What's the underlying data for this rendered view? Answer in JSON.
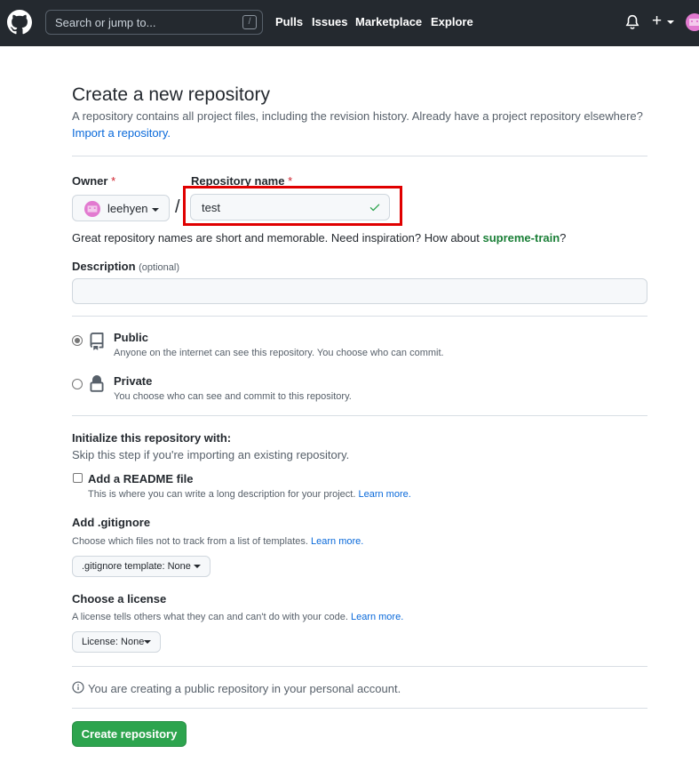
{
  "header": {
    "search_placeholder": "Search or jump to...",
    "search_key": "/",
    "nav": [
      "Pulls",
      "Issues",
      "Marketplace",
      "Explore"
    ],
    "plus_symbol": "+"
  },
  "page": {
    "title": "Create a new repository",
    "subtitle": "A repository contains all project files, including the revision history. Already have a project repository elsewhere?",
    "import_link": "Import a repository."
  },
  "owner": {
    "label": "Owner",
    "required_mark": "*",
    "value": "leehyen"
  },
  "repo_name": {
    "label": "Repository name",
    "required_mark": "*",
    "separator": "/",
    "value": "test"
  },
  "hint": {
    "prefix": "Great repository names are short and memorable. Need inspiration? How about ",
    "suggestion": "supreme-train",
    "suffix": "?"
  },
  "description": {
    "label": "Description",
    "optional": "(optional)"
  },
  "visibility": {
    "public": {
      "title": "Public",
      "desc": "Anyone on the internet can see this repository. You choose who can commit."
    },
    "private": {
      "title": "Private",
      "desc": "You choose who can see and commit to this repository."
    }
  },
  "initialize": {
    "title": "Initialize this repository with:",
    "subtitle": "Skip this step if you're importing an existing repository.",
    "readme": {
      "title": "Add a README file",
      "desc": "This is where you can write a long description for your project.",
      "link": "Learn more."
    },
    "gitignore": {
      "title": "Add .gitignore",
      "desc": "Choose which files not to track from a list of templates.",
      "link": "Learn more.",
      "select_label": ".gitignore template: None"
    },
    "license": {
      "title": "Choose a license",
      "desc": "A license tells others what they can and can't do with your code.",
      "link": "Learn more.",
      "select_label": "License: None"
    }
  },
  "notice": "You are creating a public repository in your personal account.",
  "create_button": "Create repository",
  "colors": {
    "header_bg": "#24292f",
    "primary_green": "#2da44e",
    "link_blue": "#0969da",
    "suggestion_green": "#1a7f37",
    "highlight_red": "#e00000",
    "required_red": "#cf222e"
  }
}
